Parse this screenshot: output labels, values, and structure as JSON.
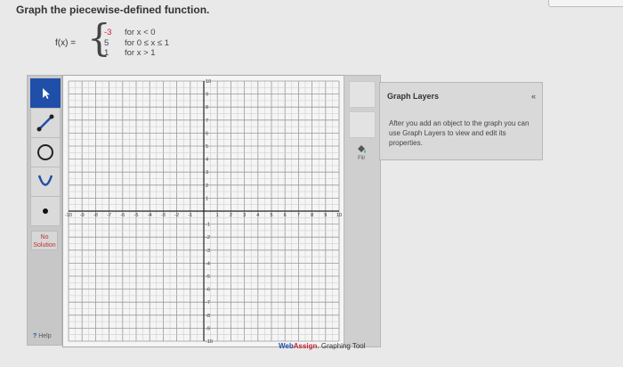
{
  "top_tab": "",
  "question": "Graph the piecewise-defined function.",
  "function": {
    "name": "f(x) =",
    "values": [
      "-3",
      "5",
      "1"
    ],
    "conditions": [
      "for x < 0",
      "for 0 ≤ x ≤ 1",
      "for x > 1"
    ]
  },
  "tools": [
    {
      "name": "pointer",
      "icon": "pointer-arrow-icon"
    },
    {
      "name": "segment",
      "icon": "line-segment-icon"
    },
    {
      "name": "circle",
      "icon": "circle-icon"
    },
    {
      "name": "parabola",
      "icon": "parabola-icon"
    },
    {
      "name": "point",
      "icon": "point-icon"
    }
  ],
  "no_solution_label": "No Solution",
  "help_label": "Help",
  "graph": {
    "x_ticks": [
      "-10",
      "-9",
      "-8",
      "-7",
      "-6",
      "-5",
      "-4",
      "-3",
      "-2",
      "-1",
      "1",
      "2",
      "3",
      "4",
      "5",
      "6",
      "7",
      "8",
      "9",
      "10"
    ],
    "y_ticks_pos": [
      "10",
      "9",
      "8",
      "7",
      "6",
      "5",
      "4",
      "3",
      "2",
      "1"
    ],
    "y_ticks_neg": [
      "-1",
      "-2",
      "-3",
      "-4",
      "-5",
      "-6",
      "-7",
      "-8",
      "-9",
      "-10"
    ],
    "xlim": [
      -10,
      10
    ],
    "ylim": [
      -10,
      10
    ]
  },
  "fill_label": "Fill",
  "brand": {
    "web": "Web",
    "assign": "Assign",
    "tool": ". Graphing Tool"
  },
  "layers": {
    "title": "Graph Layers",
    "collapse": "«",
    "description": "After you add an object to the graph you can use Graph Layers to view and edit its properties."
  }
}
